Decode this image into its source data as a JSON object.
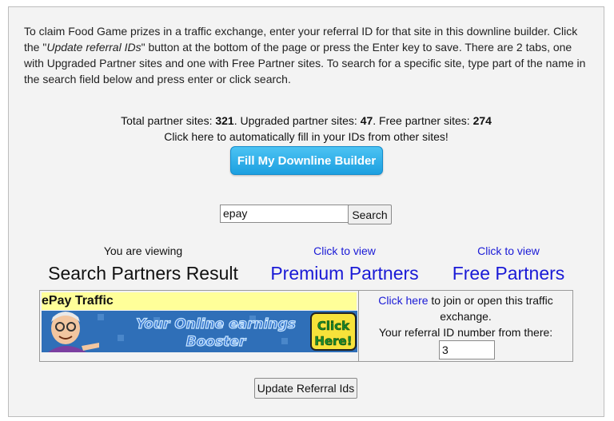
{
  "intro": {
    "part1": "To claim Food Game prizes in a traffic exchange, enter your referral ID for that site in this downline builder. Click the \"",
    "button_ref": "Update referral IDs",
    "part2": "\" button at the bottom of the page or press the Enter key to save. There are 2 tabs, one with Upgraded Partner sites and one with Free Partner sites. To search for a specific site, type part of the name in the search field below and press enter or click search."
  },
  "stats": {
    "total_label": "Total partner sites: ",
    "total_value": "321",
    "upgraded_label": ". Upgraded partner sites: ",
    "upgraded_value": "47",
    "free_label": ". Free partner sites: ",
    "free_value": "274",
    "autofill_text": "Click here to automatically fill in your IDs from other sites!"
  },
  "fill_button_label": "Fill My Downline Builder",
  "search": {
    "value": "epay",
    "button_label": "Search"
  },
  "tabs": [
    {
      "small": "You are viewing",
      "big": "Search Partners Result"
    },
    {
      "small": "Click to view",
      "big": "Premium Partners"
    },
    {
      "small": "Click to view",
      "big": "Free Partners"
    }
  ],
  "result": {
    "site_name": "ePay Traffic",
    "banner_text_line1": "Your Online earnings",
    "banner_text_line2": "Booster",
    "banner_click1": "Click",
    "banner_click2": "Here!",
    "click_here": "Click here",
    "join_text": " to join or open this traffic exchange.",
    "ref_label": "Your referral ID number from there:",
    "ref_value": "3"
  },
  "update_button_label": "Update Referral Ids",
  "colors": {
    "link": "#1a1ad6",
    "fill_button": "#25a9e8",
    "site_title_bg": "#ffff99"
  }
}
